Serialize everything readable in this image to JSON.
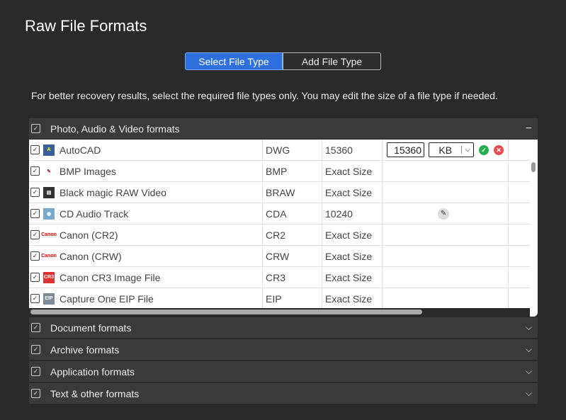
{
  "title": "Raw File Formats",
  "tabs": [
    {
      "label": "Select File Type",
      "active": true
    },
    {
      "label": "Add File Type",
      "active": false
    }
  ],
  "description": "For better recovery results, select the required file types only. You may edit the size of a file type if needed.",
  "expanded_section": {
    "label": "Photo, Audio & Video formats",
    "checked": true,
    "toggle": "−"
  },
  "rows": [
    {
      "name": "AutoCAD",
      "ext": "DWG",
      "size": "15360",
      "icon": "autocad-icon",
      "editing": true,
      "edit_value": "15360",
      "unit": "KB"
    },
    {
      "name": "BMP Images",
      "ext": "BMP",
      "size": "Exact Size",
      "icon": "bmp-icon"
    },
    {
      "name": "Black magic RAW Video",
      "ext": "BRAW",
      "size": "Exact Size",
      "icon": "film-icon"
    },
    {
      "name": "CD Audio Track",
      "ext": "CDA",
      "size": "10240",
      "icon": "cd-audio-icon",
      "show_edit": true
    },
    {
      "name": "Canon (CR2)",
      "ext": "CR2",
      "size": "Exact Size",
      "icon": "canon-icon"
    },
    {
      "name": "Canon (CRW)",
      "ext": "CRW",
      "size": "Exact Size",
      "icon": "canon-icon"
    },
    {
      "name": "Canon CR3 Image File",
      "ext": "CR3",
      "size": "Exact Size",
      "icon": "cr3-icon"
    },
    {
      "name": "Capture One EIP File",
      "ext": "EIP",
      "size": "Exact Size",
      "icon": "eip-icon"
    }
  ],
  "sections": [
    {
      "label": "Document formats",
      "checked": true
    },
    {
      "label": "Archive formats",
      "checked": true
    },
    {
      "label": "Application formats",
      "checked": true
    },
    {
      "label": "Text & other formats",
      "checked": true
    }
  ],
  "colors": {
    "accent": "#2d6fdc",
    "confirm": "#22b14c",
    "cancel": "#e84c4c"
  }
}
